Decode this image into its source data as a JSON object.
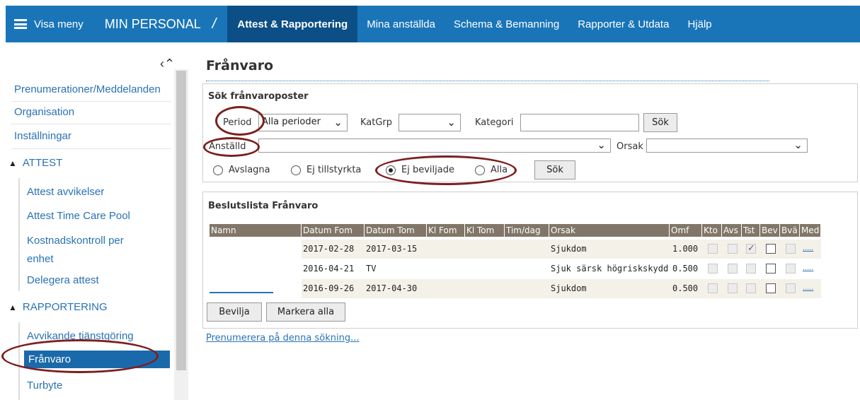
{
  "topbar": {
    "menu_label": "Visa meny",
    "app_title": "MIN PERSONAL",
    "separator": "/",
    "nav": [
      "Attest & Rapportering",
      "Mina anställda",
      "Schema & Bemanning",
      "Rapporter & Utdata",
      "Hjälp"
    ],
    "active_nav": "Attest & Rapportering",
    "color": "#1a75b8",
    "active_color": "#0b4f86"
  },
  "sidebar": {
    "items": [
      "Prenumerationer/Meddelanden",
      "Organisation",
      "Inställningar"
    ],
    "sections": [
      {
        "label": "ATTEST",
        "items": [
          "Attest avvikelser",
          "Attest Time Care Pool",
          "Kostnadskontroll per enhet",
          "Delegera attest"
        ]
      },
      {
        "label": "RAPPORTERING",
        "items": [
          "Avvikande tjänstgöring",
          "Frånvaro",
          "Turbyte"
        ]
      }
    ],
    "kostnad_line1": "Kostnadskontroll per",
    "kostnad_line2": "enhet",
    "active_item": "Frånvaro"
  },
  "page": {
    "title": "Frånvaro"
  },
  "search": {
    "heading": "Sök frånvaroposter",
    "period_label": "Period",
    "period_value": "Alla perioder",
    "katgrp_label": "KatGrp",
    "katgrp_value": "",
    "kategori_label": "Kategori",
    "kategori_value": "",
    "search_button": "Sök",
    "anstalld_label": "Anställd",
    "anstalld_value": "",
    "orsak_label": "Orsak",
    "orsak_value": "",
    "radios": [
      "Avslagna",
      "Ej tillstyrkta",
      "Ej beviljade",
      "Alla"
    ],
    "selected_radio": "Ej beviljade",
    "search_button2": "Sök"
  },
  "decisions": {
    "heading": "Beslutslista Frånvaro",
    "columns": [
      "Namn",
      "Datum Fom",
      "Datum Tom",
      "Kl Fom",
      "Kl Tom",
      "Tim/dag",
      "Orsak",
      "Omf",
      "Kto",
      "Avs",
      "Tst",
      "Bev",
      "Bvä",
      "Med"
    ],
    "rows": [
      {
        "datum_fom": "2017-02-28",
        "datum_tom": "2017-03-15",
        "kl_fom": "",
        "kl_tom": "",
        "tim_dag": "",
        "orsak": "Sjukdom",
        "omf": "1.000",
        "tst_checked": true,
        "med": "....."
      },
      {
        "datum_fom": "2016-04-21",
        "datum_tom": "TV",
        "kl_fom": "",
        "kl_tom": "",
        "tim_dag": "",
        "orsak": "Sjuk särsk högriskskydd",
        "omf": "0.500",
        "tst_checked": false,
        "med": "....."
      },
      {
        "datum_fom": "2016-09-26",
        "datum_tom": "2017-04-30",
        "kl_fom": "",
        "kl_tom": "",
        "tim_dag": "",
        "orsak": "Sjukdom",
        "omf": "0.500",
        "tst_checked": false,
        "med": "....."
      }
    ],
    "approve_button": "Bevilja",
    "mark_all_button": "Markera alla",
    "header_color": "#817668"
  },
  "subscribe_link": "Prenumerera på denna sökning...",
  "highlight_color": "#7d1f1f"
}
